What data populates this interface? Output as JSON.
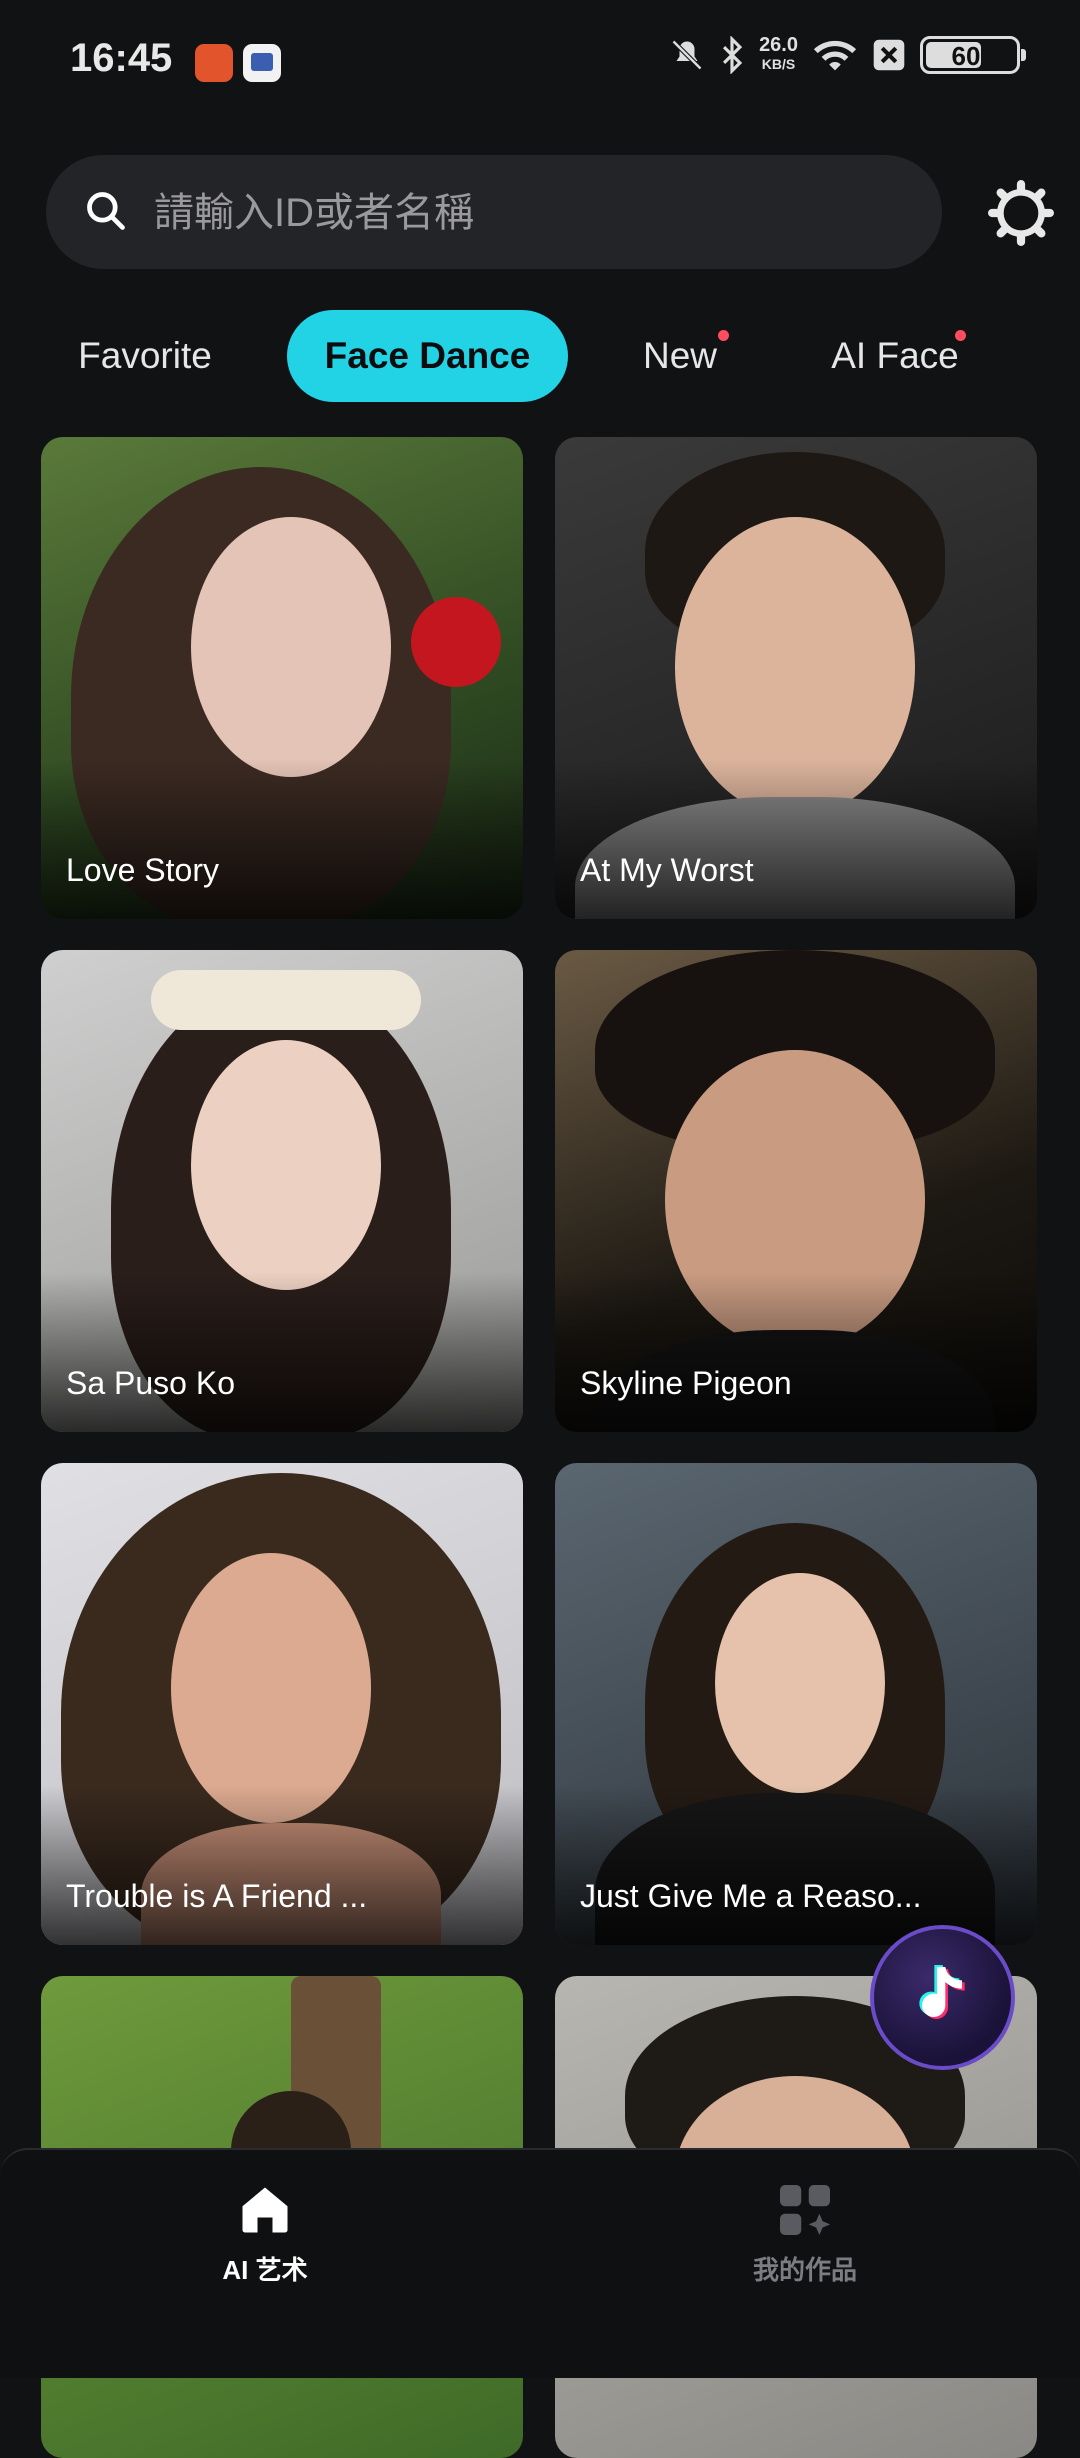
{
  "status_bar": {
    "time": "16:45",
    "net_speed_value": "26.0",
    "net_speed_unit": "KB/S",
    "battery": "60",
    "icons": [
      "mute-bell-icon",
      "bluetooth-icon",
      "wifi-icon",
      "close-box-icon"
    ]
  },
  "search": {
    "placeholder": "請輸入ID或者名稱",
    "value": ""
  },
  "tabs": [
    {
      "label": "Favorite",
      "active": false,
      "has_dot": false
    },
    {
      "label": "Face Dance",
      "active": true,
      "has_dot": false
    },
    {
      "label": "New",
      "active": false,
      "has_dot": true
    },
    {
      "label": "AI Face",
      "active": false,
      "has_dot": true
    }
  ],
  "cards": [
    {
      "title": "Love Story"
    },
    {
      "title": "At My Worst"
    },
    {
      "title": "Sa Puso Ko"
    },
    {
      "title": "Skyline Pigeon"
    },
    {
      "title": "Trouble is A Friend ..."
    },
    {
      "title": "Just Give Me a Reaso..."
    },
    {
      "title": ""
    },
    {
      "title": ""
    }
  ],
  "bottom_nav": [
    {
      "label": "AI 艺术",
      "icon": "home-icon",
      "active": true
    },
    {
      "label": "我的作品",
      "icon": "grid-works-icon",
      "active": false
    }
  ],
  "colors": {
    "accent": "#22d3e6",
    "dot": "#ff4d5e",
    "background": "#111214"
  }
}
